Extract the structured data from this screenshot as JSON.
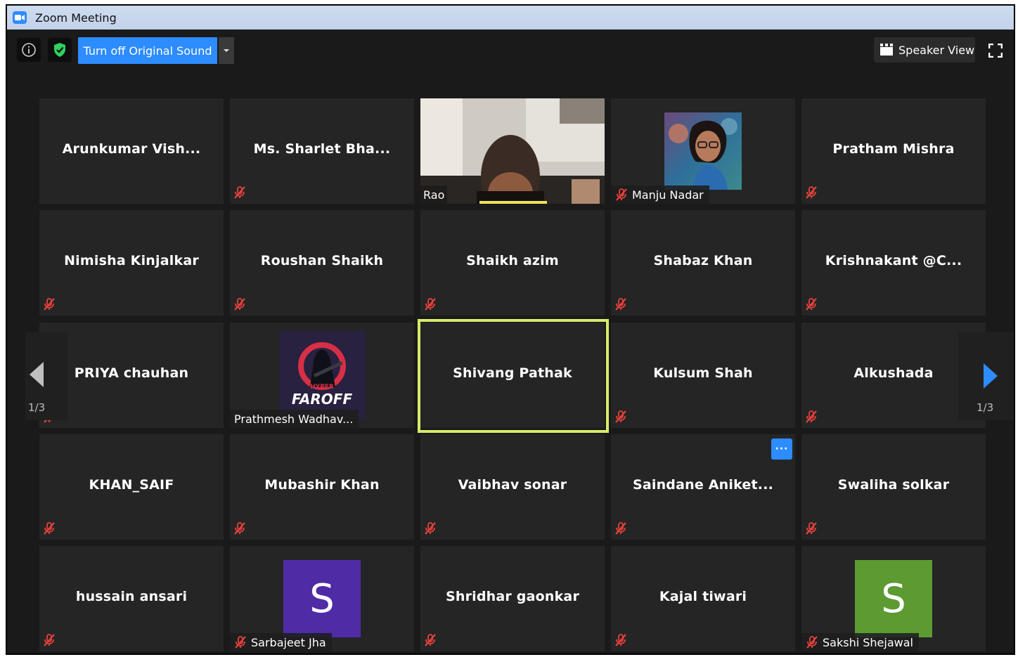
{
  "window": {
    "title": "Zoom Meeting"
  },
  "toolbar": {
    "sound_button": "Turn off Original Sound",
    "speaker_view": "Speaker View"
  },
  "pagination": {
    "left_count": "1/3",
    "right_count": "1/3"
  },
  "colors": {
    "accent": "#2d8cff",
    "tile_bg": "#252525",
    "active_speaker_border": "#d6ec6b",
    "mute_icon": "#e8413c",
    "avatar_sarbajeet": "#4f2ba6",
    "avatar_sakshi": "#5c9b32"
  },
  "participants": [
    {
      "name": "Arunkumar  Vish...",
      "muted": false,
      "kind": "name"
    },
    {
      "name": "Ms.  Sharlet  Bha...",
      "muted": true,
      "kind": "name"
    },
    {
      "name": "Rao",
      "muted": false,
      "kind": "video"
    },
    {
      "name": "Manju Nadar",
      "muted": true,
      "kind": "photo"
    },
    {
      "name": "Pratham Mishra",
      "muted": true,
      "kind": "name"
    },
    {
      "name": "Nimisha Kinjalkar",
      "muted": true,
      "kind": "name"
    },
    {
      "name": "Roushan Shaikh",
      "muted": true,
      "kind": "name"
    },
    {
      "name": "Shaikh azim",
      "muted": true,
      "kind": "name"
    },
    {
      "name": "Shabaz Khan",
      "muted": true,
      "kind": "name"
    },
    {
      "name": "Krishnakant  @C...",
      "muted": true,
      "kind": "name"
    },
    {
      "name": "PRIYA chauhan",
      "muted": true,
      "kind": "name"
    },
    {
      "name": "Prathmesh Wadhav...",
      "muted": false,
      "kind": "logo",
      "logo_text": "FAROFF",
      "logo_subtext": "HYPER"
    },
    {
      "name": "Shivang Pathak",
      "muted": false,
      "kind": "name",
      "active_speaker": true
    },
    {
      "name": "Kulsum Shah",
      "muted": true,
      "kind": "name"
    },
    {
      "name": "Alkushada",
      "muted": true,
      "kind": "name"
    },
    {
      "name": "KHAN_SAIF",
      "muted": true,
      "kind": "name"
    },
    {
      "name": "Mubashir Khan",
      "muted": true,
      "kind": "name"
    },
    {
      "name": "Vaibhav  sonar",
      "muted": true,
      "kind": "name"
    },
    {
      "name": "Saindane  Aniket...",
      "muted": true,
      "kind": "name",
      "more_button": "···"
    },
    {
      "name": "Swaliha solkar",
      "muted": true,
      "kind": "name"
    },
    {
      "name": "hussain ansari",
      "muted": true,
      "kind": "name"
    },
    {
      "name": "Sarbajeet Jha",
      "muted": true,
      "kind": "letter",
      "letter": "S"
    },
    {
      "name": "Shridhar gaonkar",
      "muted": true,
      "kind": "name"
    },
    {
      "name": "Kajal tiwari",
      "muted": true,
      "kind": "name"
    },
    {
      "name": "Sakshi Shejawal",
      "muted": true,
      "kind": "letter",
      "letter": "S"
    }
  ]
}
